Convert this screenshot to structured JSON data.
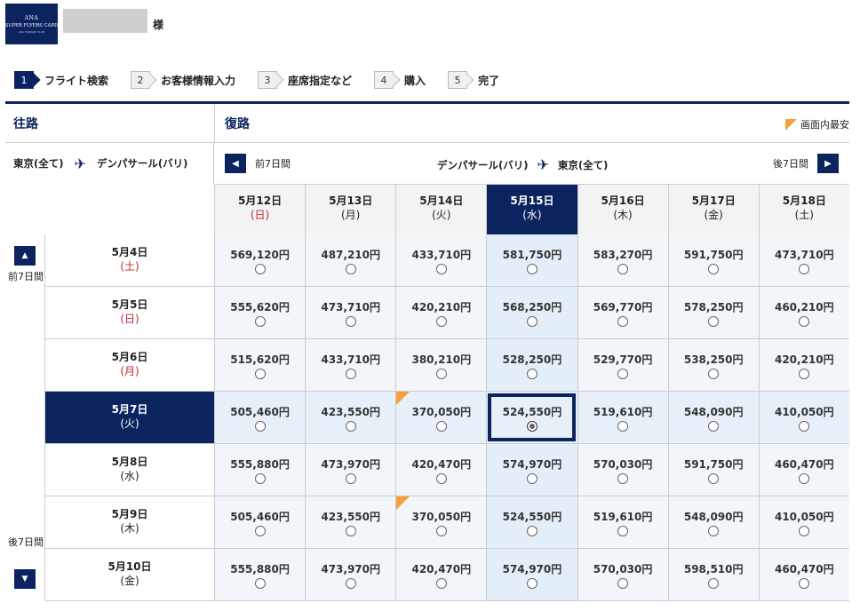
{
  "header": {
    "logo_line1": "ANA",
    "logo_line2": "SUPER FLYERS CARD",
    "logo_line3": "ANA MILEAGE CLUB",
    "honorific": "様"
  },
  "steps": [
    {
      "num": "1",
      "label": "フライト検索",
      "active": true
    },
    {
      "num": "2",
      "label": "お客様情報入力",
      "active": false
    },
    {
      "num": "3",
      "label": "座席指定など",
      "active": false
    },
    {
      "num": "4",
      "label": "購入",
      "active": false
    },
    {
      "num": "5",
      "label": "完了",
      "active": false
    }
  ],
  "outbound": {
    "heading": "往路",
    "from": "東京(全て)",
    "to": "デンパサール(バリ)",
    "prev_label": "前7日間",
    "next_label": "後7日間"
  },
  "return": {
    "heading": "復路",
    "cheapest_legend": "画面内最安",
    "from": "デンパサール(バリ)",
    "to": "東京(全て)",
    "prev_label": "前7日間",
    "next_label": "後7日間",
    "dates": [
      {
        "date": "5月12日",
        "wd": "(日)",
        "red": true
      },
      {
        "date": "5月13日",
        "wd": "(月)",
        "red": false
      },
      {
        "date": "5月14日",
        "wd": "(火)",
        "red": false
      },
      {
        "date": "5月15日",
        "wd": "(水)",
        "red": false,
        "selected": true
      },
      {
        "date": "5月16日",
        "wd": "(木)",
        "red": false
      },
      {
        "date": "5月17日",
        "wd": "(金)",
        "red": false
      },
      {
        "date": "5月18日",
        "wd": "(土)",
        "red": false
      }
    ]
  },
  "outbound_dates": [
    {
      "date": "5月4日",
      "wd": "(土)",
      "red": true
    },
    {
      "date": "5月5日",
      "wd": "(日)",
      "red": true
    },
    {
      "date": "5月6日",
      "wd": "(月)",
      "red": true
    },
    {
      "date": "5月7日",
      "wd": "(火)",
      "red": false,
      "selected": true
    },
    {
      "date": "5月8日",
      "wd": "(水)",
      "red": false
    },
    {
      "date": "5月9日",
      "wd": "(木)",
      "red": false
    },
    {
      "date": "5月10日",
      "wd": "(金)",
      "red": false
    }
  ],
  "prices": [
    [
      "569,120円",
      "487,210円",
      "433,710円",
      "581,750円",
      "583,270円",
      "591,750円",
      "473,710円"
    ],
    [
      "555,620円",
      "473,710円",
      "420,210円",
      "568,250円",
      "569,770円",
      "578,250円",
      "460,210円"
    ],
    [
      "515,620円",
      "433,710円",
      "380,210円",
      "528,250円",
      "529,770円",
      "538,250円",
      "420,210円"
    ],
    [
      "505,460円",
      "423,550円",
      "370,050円",
      "524,550円",
      "519,610円",
      "548,090円",
      "410,050円"
    ],
    [
      "555,880円",
      "473,970円",
      "420,470円",
      "574,970円",
      "570,030円",
      "591,750円",
      "460,470円"
    ],
    [
      "505,460円",
      "423,550円",
      "370,050円",
      "524,550円",
      "519,610円",
      "548,090円",
      "410,050円"
    ],
    [
      "555,880円",
      "473,970円",
      "420,470円",
      "574,970円",
      "570,030円",
      "598,510円",
      "460,470円"
    ]
  ],
  "cheapest_cells": [
    [
      3,
      2
    ],
    [
      5,
      2
    ]
  ],
  "selected_cell": [
    3,
    3
  ],
  "colors": {
    "brand": "#0b2460",
    "cheapest": "#f5a03c",
    "holiday": "#c0272d"
  }
}
